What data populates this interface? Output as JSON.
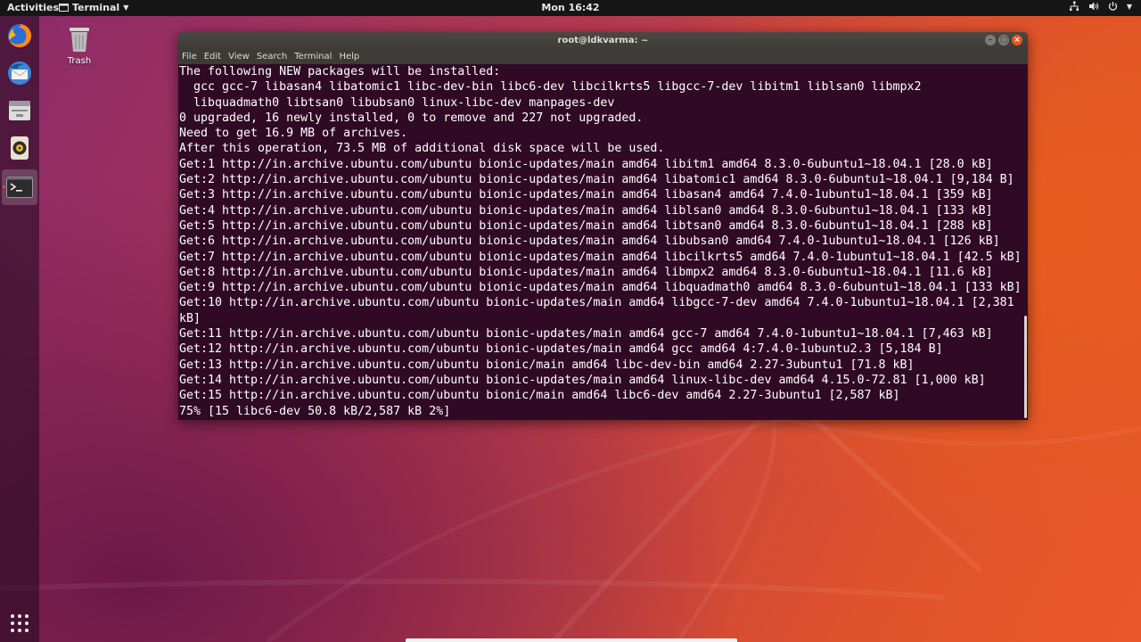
{
  "topbar": {
    "activities": "Activities",
    "app_name": "Terminal",
    "clock": "Mon 16:42"
  },
  "desktop": {
    "trash_label": "Trash"
  },
  "dock": {
    "items": [
      {
        "name": "firefox-icon"
      },
      {
        "name": "thunderbird-icon"
      },
      {
        "name": "files-icon"
      },
      {
        "name": "rhythmbox-icon"
      },
      {
        "name": "terminal-icon",
        "active": true
      }
    ]
  },
  "terminal": {
    "title": "root@ldkvarma: ~",
    "menu": [
      "File",
      "Edit",
      "View",
      "Search",
      "Terminal",
      "Help"
    ],
    "lines": [
      "The following NEW packages will be installed:",
      "  gcc gcc-7 libasan4 libatomic1 libc-dev-bin libc6-dev libcilkrts5 libgcc-7-dev libitm1 liblsan0 libmpx2",
      "  libquadmath0 libtsan0 libubsan0 linux-libc-dev manpages-dev",
      "0 upgraded, 16 newly installed, 0 to remove and 227 not upgraded.",
      "Need to get 16.9 MB of archives.",
      "After this operation, 73.5 MB of additional disk space will be used.",
      "Get:1 http://in.archive.ubuntu.com/ubuntu bionic-updates/main amd64 libitm1 amd64 8.3.0-6ubuntu1~18.04.1 [28.0 kB]",
      "Get:2 http://in.archive.ubuntu.com/ubuntu bionic-updates/main amd64 libatomic1 amd64 8.3.0-6ubuntu1~18.04.1 [9,184 B]",
      "Get:3 http://in.archive.ubuntu.com/ubuntu bionic-updates/main amd64 libasan4 amd64 7.4.0-1ubuntu1~18.04.1 [359 kB]",
      "Get:4 http://in.archive.ubuntu.com/ubuntu bionic-updates/main amd64 liblsan0 amd64 8.3.0-6ubuntu1~18.04.1 [133 kB]",
      "Get:5 http://in.archive.ubuntu.com/ubuntu bionic-updates/main amd64 libtsan0 amd64 8.3.0-6ubuntu1~18.04.1 [288 kB]",
      "Get:6 http://in.archive.ubuntu.com/ubuntu bionic-updates/main amd64 libubsan0 amd64 7.4.0-1ubuntu1~18.04.1 [126 kB]",
      "Get:7 http://in.archive.ubuntu.com/ubuntu bionic-updates/main amd64 libcilkrts5 amd64 7.4.0-1ubuntu1~18.04.1 [42.5 kB]",
      "Get:8 http://in.archive.ubuntu.com/ubuntu bionic-updates/main amd64 libmpx2 amd64 8.3.0-6ubuntu1~18.04.1 [11.6 kB]",
      "Get:9 http://in.archive.ubuntu.com/ubuntu bionic-updates/main amd64 libquadmath0 amd64 8.3.0-6ubuntu1~18.04.1 [133 kB]",
      "Get:10 http://in.archive.ubuntu.com/ubuntu bionic-updates/main amd64 libgcc-7-dev amd64 7.4.0-1ubuntu1~18.04.1 [2,381",
      "kB]",
      "Get:11 http://in.archive.ubuntu.com/ubuntu bionic-updates/main amd64 gcc-7 amd64 7.4.0-1ubuntu1~18.04.1 [7,463 kB]",
      "Get:12 http://in.archive.ubuntu.com/ubuntu bionic-updates/main amd64 gcc amd64 4:7.4.0-1ubuntu2.3 [5,184 B]",
      "Get:13 http://in.archive.ubuntu.com/ubuntu bionic/main amd64 libc-dev-bin amd64 2.27-3ubuntu1 [71.8 kB]",
      "Get:14 http://in.archive.ubuntu.com/ubuntu bionic-updates/main amd64 linux-libc-dev amd64 4.15.0-72.81 [1,000 kB]",
      "Get:15 http://in.archive.ubuntu.com/ubuntu bionic/main amd64 libc6-dev amd64 2.27-3ubuntu1 [2,587 kB]",
      "75% [15 libc6-dev 50.8 kB/2,587 kB 2%]"
    ]
  },
  "colors": {
    "terminal_bg": "#300a24",
    "accent": "#e95420",
    "topbar_bg": "#161616"
  }
}
